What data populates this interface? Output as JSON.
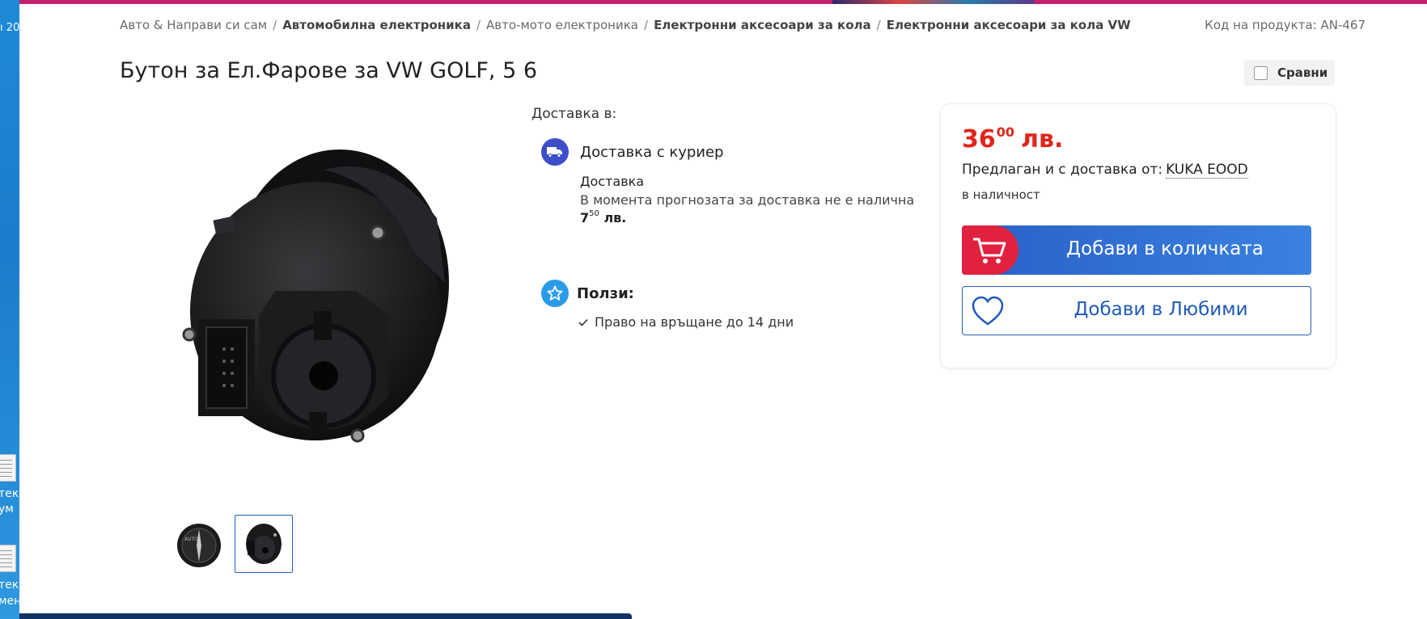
{
  "desktop": {
    "top_text": "ı 20",
    "icons": [
      {
        "line1": "тек",
        "line2": "ум"
      },
      {
        "line1": "тек",
        "line2": "мен"
      }
    ]
  },
  "breadcrumb": [
    {
      "label": "Авто & Направи си сам",
      "bold": false
    },
    {
      "label": "Автомобилна електроника",
      "bold": true
    },
    {
      "label": "Авто-мото електроника",
      "bold": false
    },
    {
      "label": "Електронни аксесоари за кола",
      "bold": true
    },
    {
      "label": "Електронни аксесоари за кола VW",
      "bold": true
    }
  ],
  "breadcrumb_sep": "/",
  "product_code": "Код на продукта: AN-467",
  "title": "Бутон за Ел.Фарове за VW GOLF, 5 6",
  "compare_label": "Сравни",
  "delivery": {
    "heading": "Доставка в:",
    "courier_title": "Доставка с куриер",
    "label": "Доставка",
    "note": "В момента прогнозата за доставка не е налична",
    "price_int": "7",
    "price_dec": "50",
    "price_cur": "лв."
  },
  "benefits": {
    "title": "Ползи:",
    "items": [
      "Право на връщане до 14 дни"
    ]
  },
  "offer": {
    "price_int": "36",
    "price_dec": "00",
    "currency": "лв.",
    "seller_prefix": "Предлаган и с доставка от:",
    "seller_name": "KUKA EOOD",
    "stock": "в наличност",
    "add_to_cart": "Добави в количката",
    "add_to_favorites": "Добави в Любими"
  },
  "colors": {
    "accent_pink": "#c2206f",
    "price_red": "#e0261c",
    "button_blue": "#2960c7",
    "button_red": "#e0223f",
    "courier_icon_bg": "#3d4ec9",
    "benefit_icon_bg": "#2a9be8"
  },
  "icons": {
    "courier": "truck-icon",
    "benefit": "star-icon",
    "cart": "cart-icon",
    "favorite": "heart-icon",
    "check": "check-icon"
  }
}
